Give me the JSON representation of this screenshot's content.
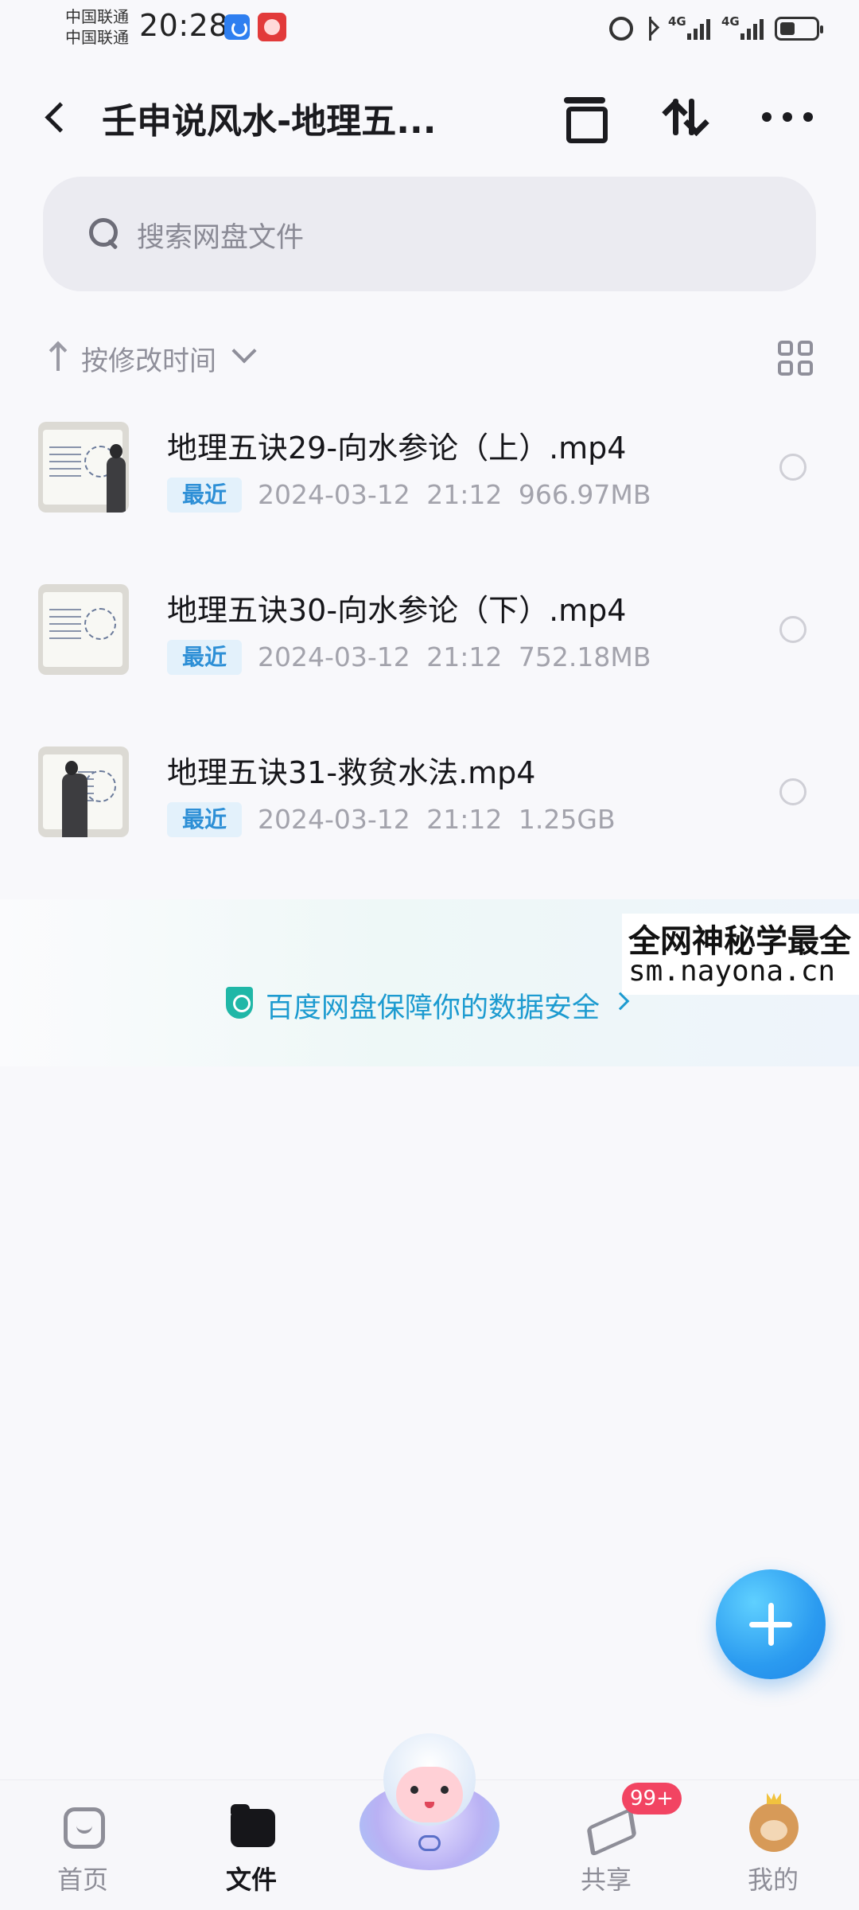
{
  "status_bar": {
    "carrier_1": "中国联通",
    "carrier_2": "中国联通",
    "time": "20:28",
    "network_1": "4G",
    "network_2": "4G"
  },
  "header": {
    "title": "壬申说风水-地理五..."
  },
  "search": {
    "placeholder": "搜索网盘文件"
  },
  "sort": {
    "label": "按修改时间"
  },
  "files": [
    {
      "name": "地理五诀29-向水参论（上）.mp4",
      "badge": "最近",
      "date": "2024-03-12",
      "time": "21:12",
      "size": "966.97MB"
    },
    {
      "name": "地理五诀30-向水参论（下）.mp4",
      "badge": "最近",
      "date": "2024-03-12",
      "time": "21:12",
      "size": "752.18MB"
    },
    {
      "name": "地理五诀31-救贫水法.mp4",
      "badge": "最近",
      "date": "2024-03-12",
      "time": "21:12",
      "size": "1.25GB"
    }
  ],
  "watermark": {
    "line1": "全网神秘学最全",
    "line2": "sm.nayona.cn"
  },
  "security_banner": {
    "text": "百度网盘保障你的数据安全"
  },
  "bottom_nav": {
    "items": [
      {
        "label": "首页",
        "active": false
      },
      {
        "label": "文件",
        "active": true
      },
      {
        "label": "共享",
        "active": false
      },
      {
        "label": "我的",
        "active": false
      }
    ],
    "share_badge": "99+"
  },
  "colors": {
    "accent": "#2b9bf0",
    "badge_red": "#f24462",
    "recent_badge_text": "#2d8fd6",
    "security_text": "#1d9bd0"
  }
}
